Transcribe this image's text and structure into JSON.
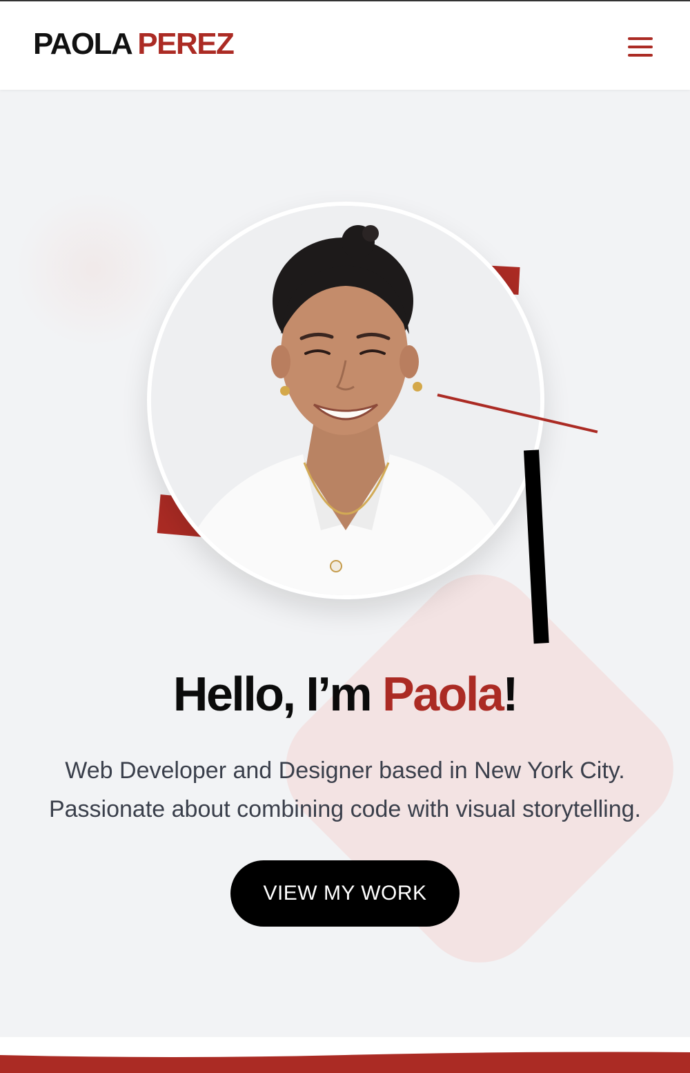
{
  "header": {
    "brand_first": "PAOLA",
    "brand_last": "PEREZ",
    "menu_icon": "hamburger-icon"
  },
  "hero": {
    "greeting_prefix": "Hello, I’m ",
    "greeting_name": "Paola",
    "greeting_suffix": "!",
    "subtitle_line1": "Web Developer and Designer based in New York City.",
    "subtitle_line2": "Passionate about combining code with visual storytelling.",
    "cta_label": "VIEW MY WORK",
    "portrait_alt": "Portrait of Paola Perez"
  },
  "colors": {
    "accent": "#ab2b24",
    "text_dark": "#0b0b0b",
    "background": "#f2f3f5",
    "blob": "#f3e3e3"
  }
}
